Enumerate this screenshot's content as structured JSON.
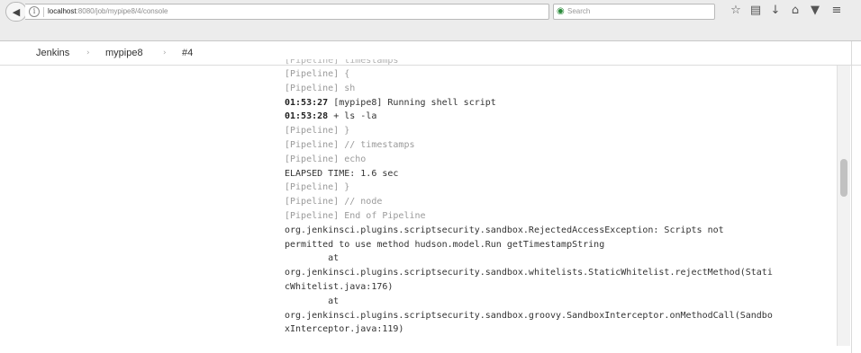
{
  "browser": {
    "url_host": "localhost",
    "url_rest": ":8080/job/mypipe8/4/console",
    "search_placeholder": "Search",
    "icons": [
      "back-icon",
      "info-icon",
      "reload-icon",
      "search-engine-icon",
      "star-icon",
      "reading-list-icon",
      "download-icon",
      "home-icon",
      "pocket-icon",
      "menu-icon"
    ]
  },
  "breadcrumb": {
    "items": [
      "Jenkins",
      "mypipe8",
      "#4"
    ],
    "separator": "›"
  },
  "console": {
    "lines": [
      {
        "text": "[Pipeline] timestamps",
        "kind": "pipeline-cut"
      },
      {
        "text": "[Pipeline] {",
        "kind": "pipeline"
      },
      {
        "text": "[Pipeline] sh",
        "kind": "pipeline"
      },
      {
        "ts": "01:53:27",
        "text": " [mypipe8] Running shell script",
        "kind": "ts"
      },
      {
        "ts": "01:53:28",
        "text": " + ls -la",
        "kind": "ts"
      },
      {
        "text": "[Pipeline] }",
        "kind": "pipeline"
      },
      {
        "text": "[Pipeline] // timestamps",
        "kind": "pipeline"
      },
      {
        "text": "[Pipeline] echo",
        "kind": "pipeline"
      },
      {
        "text": "ELAPSED TIME: 1.6 sec",
        "kind": "out"
      },
      {
        "text": "[Pipeline] }",
        "kind": "pipeline"
      },
      {
        "text": "[Pipeline] // node",
        "kind": "pipeline"
      },
      {
        "text": "[Pipeline] End of Pipeline",
        "kind": "pipeline"
      },
      {
        "text": "org.jenkinsci.plugins.scriptsecurity.sandbox.RejectedAccessException: Scripts not",
        "kind": "out"
      },
      {
        "text": "permitted to use method hudson.model.Run getTimestampString",
        "kind": "out"
      },
      {
        "text": "        at",
        "kind": "out"
      },
      {
        "text": "org.jenkinsci.plugins.scriptsecurity.sandbox.whitelists.StaticWhitelist.rejectMethod(Stati",
        "kind": "out"
      },
      {
        "text": "cWhitelist.java:176)",
        "kind": "out"
      },
      {
        "text": "        at",
        "kind": "out"
      },
      {
        "text": "org.jenkinsci.plugins.scriptsecurity.sandbox.groovy.SandboxInterceptor.onMethodCall(Sandbo",
        "kind": "out"
      },
      {
        "text": "xInterceptor.java:119)",
        "kind": "out"
      }
    ]
  }
}
